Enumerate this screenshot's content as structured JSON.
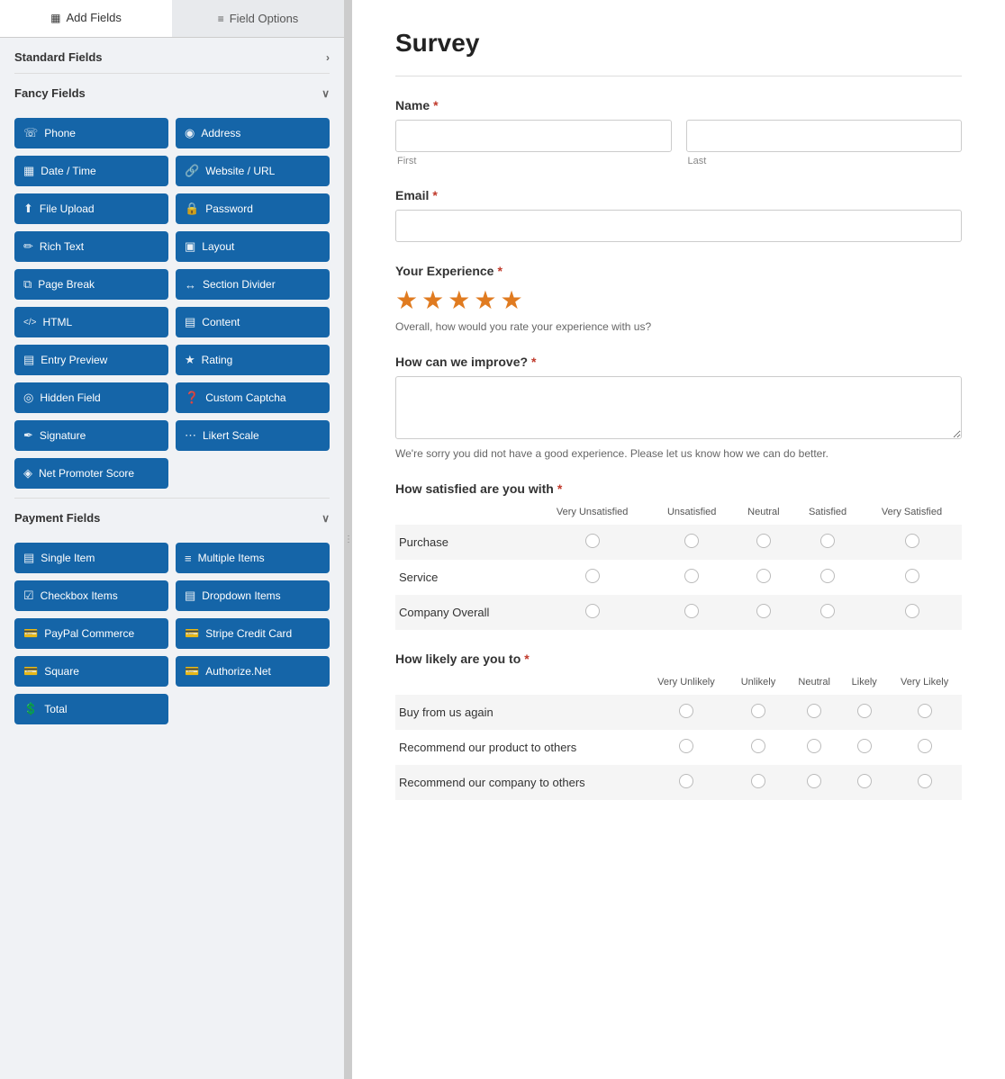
{
  "tabs": [
    {
      "label": "Add Fields",
      "icon": "▦",
      "active": true
    },
    {
      "label": "Field Options",
      "icon": "≡",
      "active": false
    }
  ],
  "sidebar": {
    "standard_fields": {
      "label": "Standard Fields",
      "collapsed": false,
      "chevron": "›"
    },
    "fancy_fields": {
      "label": "Fancy Fields",
      "collapsed": false,
      "chevron": "∨",
      "buttons": [
        {
          "label": "Phone",
          "icon": "📞",
          "id": "phone"
        },
        {
          "label": "Address",
          "icon": "📍",
          "id": "address"
        },
        {
          "label": "Date / Time",
          "icon": "📅",
          "id": "datetime"
        },
        {
          "label": "Website / URL",
          "icon": "🔗",
          "id": "website"
        },
        {
          "label": "File Upload",
          "icon": "⬆",
          "id": "file-upload"
        },
        {
          "label": "Password",
          "icon": "🔒",
          "id": "password"
        },
        {
          "label": "Rich Text",
          "icon": "✏",
          "id": "rich-text"
        },
        {
          "label": "Layout",
          "icon": "▣",
          "id": "layout"
        },
        {
          "label": "Page Break",
          "icon": "⧉",
          "id": "page-break"
        },
        {
          "label": "Section Divider",
          "icon": "↔",
          "id": "section-divider"
        },
        {
          "label": "HTML",
          "icon": "</>",
          "id": "html"
        },
        {
          "label": "Content",
          "icon": "▤",
          "id": "content"
        },
        {
          "label": "Entry Preview",
          "icon": "▤",
          "id": "entry-preview"
        },
        {
          "label": "Rating",
          "icon": "★",
          "id": "rating"
        },
        {
          "label": "Hidden Field",
          "icon": "👁",
          "id": "hidden-field"
        },
        {
          "label": "Custom Captcha",
          "icon": "❓",
          "id": "custom-captcha"
        },
        {
          "label": "Signature",
          "icon": "✏",
          "id": "signature"
        },
        {
          "label": "Likert Scale",
          "icon": "…",
          "id": "likert-scale"
        },
        {
          "label": "Net Promoter Score",
          "icon": "◈",
          "id": "net-promoter-score",
          "full": true
        }
      ]
    },
    "payment_fields": {
      "label": "Payment Fields",
      "collapsed": false,
      "chevron": "∨",
      "buttons": [
        {
          "label": "Single Item",
          "icon": "▤",
          "id": "single-item"
        },
        {
          "label": "Multiple Items",
          "icon": "≡",
          "id": "multiple-items"
        },
        {
          "label": "Checkbox Items",
          "icon": "☑",
          "id": "checkbox-items"
        },
        {
          "label": "Dropdown Items",
          "icon": "▤",
          "id": "dropdown-items"
        },
        {
          "label": "PayPal Commerce",
          "icon": "💳",
          "id": "paypal"
        },
        {
          "label": "Stripe Credit Card",
          "icon": "💳",
          "id": "stripe"
        },
        {
          "label": "Square",
          "icon": "💳",
          "id": "square"
        },
        {
          "label": "Authorize.Net",
          "icon": "💳",
          "id": "authorizenet"
        },
        {
          "label": "Total",
          "icon": "💲",
          "id": "total",
          "full": true
        }
      ]
    }
  },
  "form": {
    "title": "Survey",
    "name_field": {
      "label": "Name",
      "required": true,
      "first_placeholder": "",
      "last_placeholder": "",
      "first_sub": "First",
      "last_sub": "Last"
    },
    "email_field": {
      "label": "Email",
      "required": true
    },
    "experience_field": {
      "label": "Your Experience",
      "required": true,
      "stars": 5,
      "description": "Overall, how would you rate your experience with us?"
    },
    "improve_field": {
      "label": "How can we improve?",
      "required": true,
      "helper": "We're sorry you did not have a good experience. Please let us know how we can do better."
    },
    "satisfied_field": {
      "label": "How satisfied are you with",
      "required": true,
      "columns": [
        "Very Unsatisfied",
        "Unsatisfied",
        "Neutral",
        "Satisfied",
        "Very Satisfied"
      ],
      "rows": [
        "Purchase",
        "Service",
        "Company Overall"
      ]
    },
    "likely_field": {
      "label": "How likely are you to",
      "required": true,
      "columns": [
        "Very Unlikely",
        "Unlikely",
        "Neutral",
        "Likely",
        "Very Likely"
      ],
      "rows": [
        "Buy from us again",
        "Recommend our product to others",
        "Recommend our company to others"
      ]
    }
  }
}
